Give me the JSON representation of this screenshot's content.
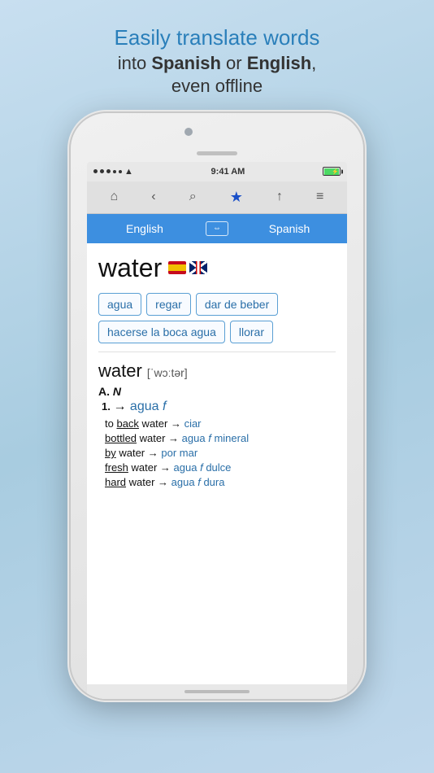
{
  "header": {
    "line1": "Easily translate words",
    "line2_pre": "into ",
    "line2_bold1": "Spanish",
    "line2_mid": " or ",
    "line2_bold2": "English",
    "line2_post": ",",
    "line3": "even offline"
  },
  "status_bar": {
    "time": "9:41 AM"
  },
  "lang_bar": {
    "lang1": "English",
    "lang2": "Spanish",
    "arrows": "⇔"
  },
  "word": {
    "main": "water",
    "phonetic": "['wɔːtər]",
    "pos": "A.",
    "pos_label": "N",
    "def_number": "1.",
    "def_arrow": "→",
    "def_trans": "agua",
    "def_italic": "f"
  },
  "chips": [
    {
      "label": "agua"
    },
    {
      "label": "regar"
    },
    {
      "label": "dar de beber"
    },
    {
      "label": "hacerse la boca agua"
    },
    {
      "label": "llorar"
    }
  ],
  "examples": [
    {
      "pre": "to ",
      "keyword": "back",
      "mid": " water",
      "arrow": " → ",
      "trans": "ciar"
    },
    {
      "pre": "",
      "keyword": "bottled",
      "mid": " water",
      "arrow": " → ",
      "trans": "agua",
      "trans_italic": "f",
      "trans2": " mineral"
    },
    {
      "pre": "",
      "keyword": "by",
      "mid": " water",
      "arrow": " → ",
      "trans": "por mar"
    },
    {
      "pre": "",
      "keyword": "fresh",
      "mid": " water",
      "arrow": " → ",
      "trans": "agua",
      "trans_italic": "f",
      "trans2": " dulce"
    },
    {
      "pre": "",
      "keyword": "hard",
      "mid": " water",
      "arrow": " → ",
      "trans": "agua",
      "trans_italic": "f",
      "trans2": " dura"
    }
  ],
  "toolbar": {
    "home": "⌂",
    "back": "‹",
    "search": "⌕",
    "star": "★",
    "share": "↑",
    "menu": "≡"
  }
}
